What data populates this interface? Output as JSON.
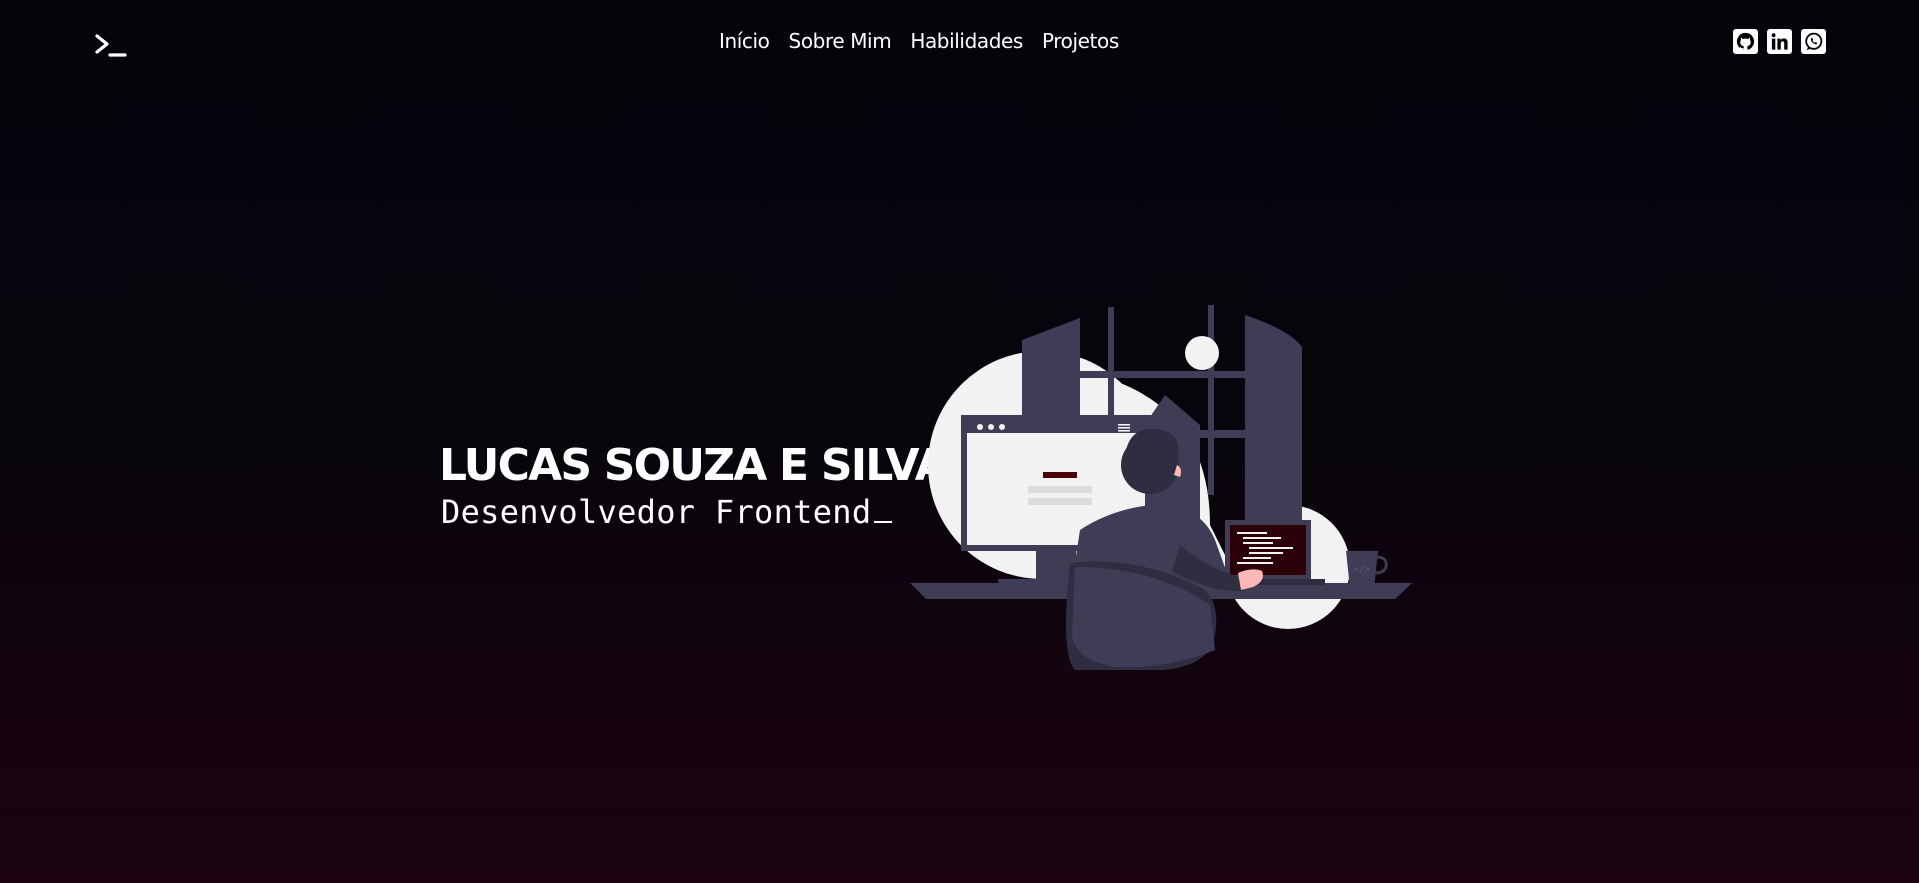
{
  "brand": {
    "logo_icon": "terminal-prompt-icon"
  },
  "nav": {
    "items": [
      {
        "label": "Início"
      },
      {
        "label": "Sobre Mim"
      },
      {
        "label": "Habilidades"
      },
      {
        "label": "Projetos"
      }
    ]
  },
  "social": {
    "icons": [
      "github-icon",
      "linkedin-icon",
      "whatsapp-icon"
    ]
  },
  "hero": {
    "name": "LUCAS SOUZA E SILVA",
    "role": "Desenvolvedor Frontend"
  },
  "colors": {
    "background_top": "#04050b",
    "background_bottom": "#1c0210",
    "text": "#ffffff",
    "accent": "#4a0008",
    "illustration_dark": "#3f3d56",
    "illustration_light": "#f2f2f2"
  }
}
